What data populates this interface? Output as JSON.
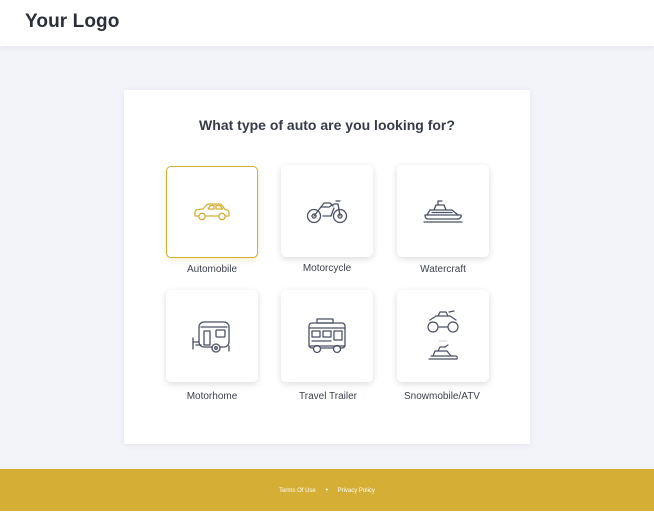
{
  "header": {
    "logo_text": "Your Logo"
  },
  "main": {
    "question": "What type of auto are you looking for?",
    "options": [
      {
        "label": "Automobile",
        "icon": "car-icon",
        "selected": true
      },
      {
        "label": "Motorcycle",
        "icon": "motorcycle-icon",
        "selected": false
      },
      {
        "label": "Watercraft",
        "icon": "jet-ski-icon",
        "selected": false
      },
      {
        "label": "Motorhome",
        "icon": "camper-trailer-icon",
        "selected": false
      },
      {
        "label": "Travel Trailer",
        "icon": "rv-bus-icon",
        "selected": false
      },
      {
        "label": "Snowmobile/ATV",
        "icon": "atv-snowmobile-icon",
        "selected": false
      }
    ]
  },
  "footer": {
    "terms_label": "Terms Of Use",
    "separator": "•",
    "privacy_label": "Privacy Policy"
  },
  "colors": {
    "accent": "#d4ae35",
    "icon_stroke": "#4a5066",
    "background": "#f3f4fa"
  }
}
